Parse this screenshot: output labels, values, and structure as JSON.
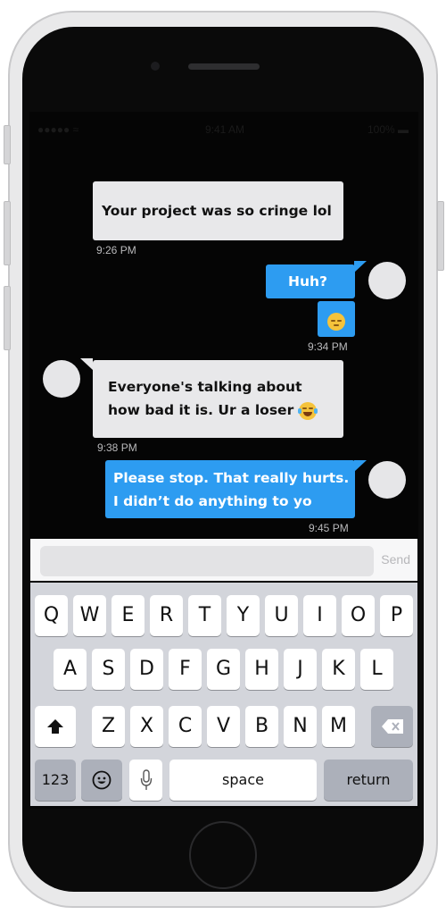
{
  "status_bar": {
    "carrier": "●●●●● ≈",
    "time": "9:41 AM",
    "battery": "100% ▬"
  },
  "messages": [
    {
      "id": "m1",
      "side": "left",
      "text": "Your project was so cringe lol",
      "time": "9:26 PM"
    },
    {
      "id": "m2",
      "side": "right",
      "text": "Huh?",
      "time": ""
    },
    {
      "id": "m3",
      "side": "right",
      "emoji": "pensive-face",
      "time": "9:34 PM"
    },
    {
      "id": "m4",
      "side": "left",
      "lines": [
        "Everyone's talking about",
        "how bad it is. Ur a loser"
      ],
      "emoji": "face-with-tears-of-joy",
      "time": "9:38 PM"
    },
    {
      "id": "m5",
      "side": "right",
      "lines": [
        "Please stop. That really hurts.",
        "I didn’t do anything to yo"
      ],
      "time": "9:45 PM"
    }
  ],
  "composer": {
    "placeholder": "",
    "send_label": "Send"
  },
  "keyboard": {
    "row1": [
      "Q",
      "W",
      "E",
      "R",
      "T",
      "Y",
      "U",
      "I",
      "O",
      "P"
    ],
    "row2": [
      "A",
      "S",
      "D",
      "F",
      "G",
      "H",
      "J",
      "K",
      "L"
    ],
    "row3": [
      "Z",
      "X",
      "C",
      "V",
      "B",
      "N",
      "M"
    ],
    "numbers_label": "123",
    "space_label": "space",
    "return_label": "return"
  },
  "colors": {
    "incoming_bubble": "#e8e8ea",
    "outgoing_bubble": "#2d9cf1",
    "screen": "#050505",
    "keyboard": "#d3d5db"
  }
}
